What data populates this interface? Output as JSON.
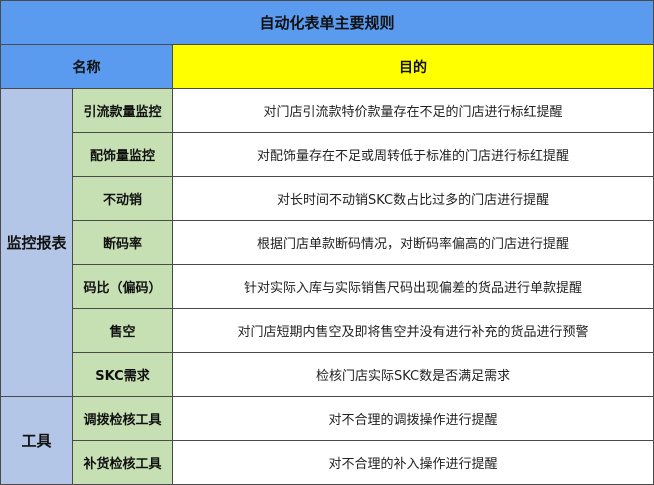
{
  "title": "自动化表单主要规则",
  "header": {
    "name": "名称",
    "purpose": "目的"
  },
  "groups": [
    {
      "label": "监控报表",
      "rows": [
        {
          "name": "引流款量监控",
          "purpose": "对门店引流款特价款量存在不足的门店进行标红提醒"
        },
        {
          "name": "配饰量监控",
          "purpose": "对配饰量存在不足或周转低于标准的门店进行标红提醒"
        },
        {
          "name": "不动销",
          "purpose": "对长时间不动销SKC数占比过多的门店进行提醒"
        },
        {
          "name": "断码率",
          "purpose": "根据门店单款断码情况，对断码率偏高的门店进行提醒"
        },
        {
          "name": "码比（偏码）",
          "purpose": "针对实际入库与实际销售尺码出现偏差的货品进行单款提醒"
        },
        {
          "name": "售空",
          "purpose": "对门店短期内售空及即将售空并没有进行补充的货品进行预警"
        },
        {
          "name": "SKC需求",
          "purpose": "检核门店实际SKC数是否满足需求"
        }
      ]
    },
    {
      "label": "工具",
      "rows": [
        {
          "name": "调拨检核工具",
          "purpose": "对不合理的调拨操作进行提醒"
        },
        {
          "name": "补货检核工具",
          "purpose": "对不合理的补入操作进行提醒"
        }
      ]
    }
  ]
}
